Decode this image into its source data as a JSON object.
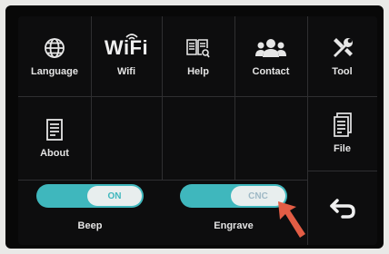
{
  "menu": {
    "items": [
      {
        "label": "Language",
        "icon": "globe-icon"
      },
      {
        "label": "Wifi",
        "icon_text": "WiFi",
        "icon": "wifi-icon"
      },
      {
        "label": "Help",
        "icon": "book-icon"
      },
      {
        "label": "Contact",
        "icon": "people-icon"
      },
      {
        "label": "About",
        "icon": "document-icon"
      }
    ]
  },
  "sidebar": {
    "tool_label": "Tool",
    "file_label": "File",
    "back_icon": "back-arrow-icon"
  },
  "toggles": {
    "beep": {
      "label": "Beep",
      "state_text": "ON"
    },
    "engrave": {
      "label": "Engrave",
      "state_text": "CNC"
    }
  },
  "colors": {
    "accent": "#3fb7bd",
    "background": "#0d0d0e",
    "text": "#e4e4e4",
    "pointer_arrow": "#e35d45"
  }
}
